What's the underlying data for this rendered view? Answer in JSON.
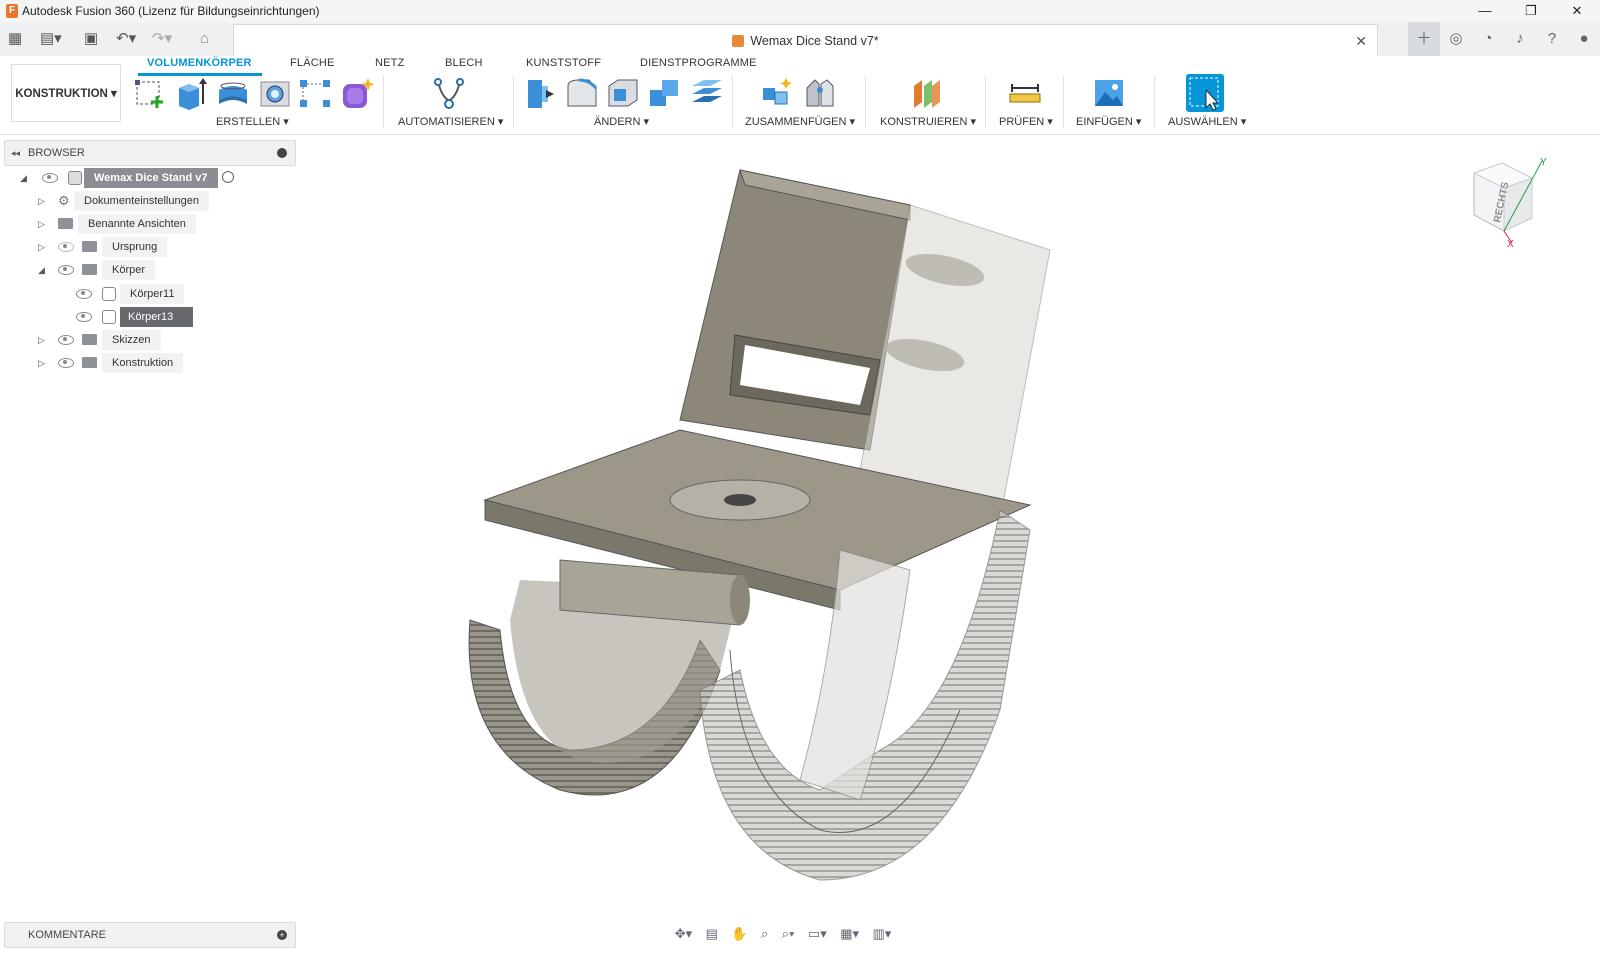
{
  "window": {
    "title": "Autodesk Fusion 360 (Lizenz für Bildungseinrichtungen)",
    "minimize": "—",
    "restore": "❐",
    "close": "✕"
  },
  "doc_tab": {
    "title": "Wemax Dice Stand v7*",
    "close": "✕"
  },
  "workspace": {
    "label": "KONSTRUKTION ▾"
  },
  "ribbon_tabs": [
    "VOLUMENKÖRPER",
    "FLÄCHE",
    "NETZ",
    "BLECH",
    "KUNSTSTOFF",
    "DIENSTPROGRAMME"
  ],
  "groups": {
    "create": "ERSTELLEN ▾",
    "automate": "AUTOMATISIEREN ▾",
    "modify": "ÄNDERN ▾",
    "assemble": "ZUSAMMENFÜGEN ▾",
    "construct": "KONSTRUIEREN ▾",
    "inspect": "PRÜFEN ▾",
    "insert": "EINFÜGEN ▾",
    "select": "AUSWÄHLEN ▾"
  },
  "browser": {
    "title": "BROWSER",
    "root": "Wemax Dice Stand v7",
    "items": {
      "doc_settings": "Dokumenteinstellungen",
      "named_views": "Benannte Ansichten",
      "origin": "Ursprung",
      "bodies": "Körper",
      "body11": "Körper11",
      "body13": "Körper13",
      "sketches": "Skizzen",
      "construction": "Konstruktion"
    }
  },
  "comments": {
    "title": "KOMMENTARE"
  },
  "viewcube": {
    "face": "RECHTS",
    "axis_y": "Y",
    "axis_x": "X"
  },
  "colors": {
    "accent": "#0696d7",
    "body": "#8c8778",
    "selected_row": "#666a6f"
  }
}
